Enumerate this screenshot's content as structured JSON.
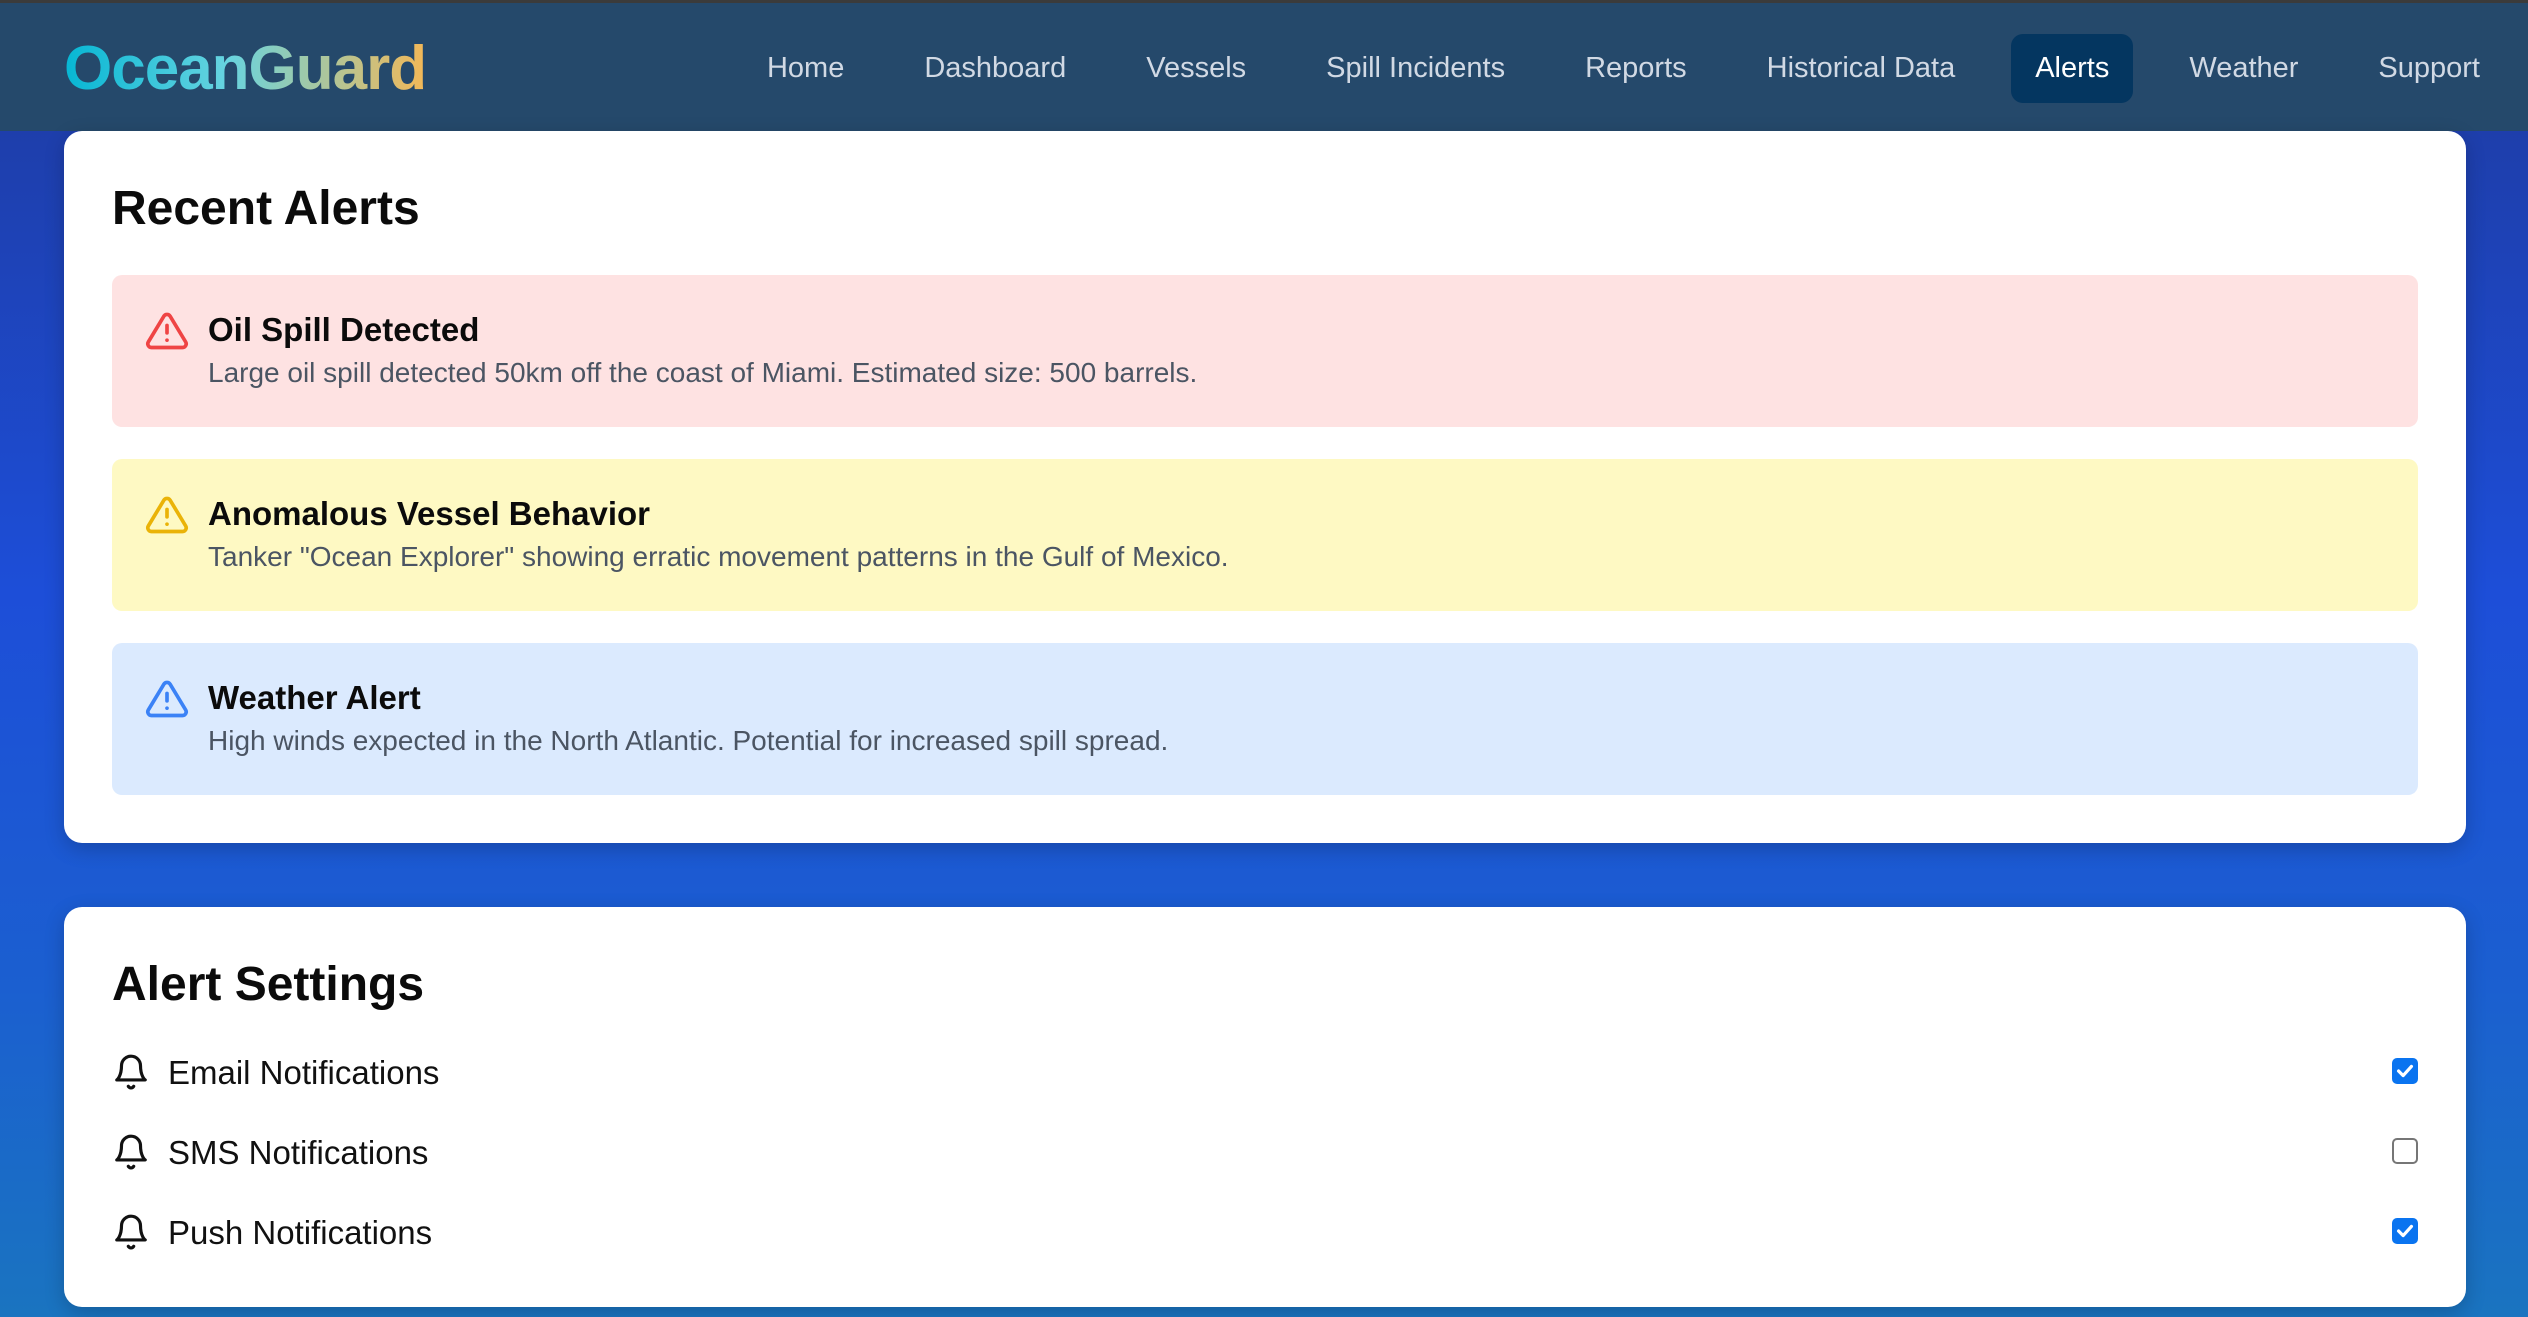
{
  "header": {
    "logo": "OceanGuard",
    "nav": [
      "Home",
      "Dashboard",
      "Vessels",
      "Spill Incidents",
      "Reports",
      "Historical Data",
      "Alerts",
      "Weather",
      "Support"
    ],
    "active": "Alerts"
  },
  "recent": {
    "title": "Recent Alerts",
    "alerts": [
      {
        "title": "Oil Spill Detected",
        "desc": "Large oil spill detected 50km off the coast of Miami. Estimated size: 500 barrels.",
        "icon": "warning-triangle-icon",
        "color": "#ef4444",
        "bg": "#fee2e2"
      },
      {
        "title": "Anomalous Vessel Behavior",
        "desc": "Tanker \"Ocean Explorer\" showing erratic movement patterns in the Gulf of Mexico.",
        "icon": "warning-triangle-icon",
        "color": "#eab308",
        "bg": "#fef9c3"
      },
      {
        "title": "Weather Alert",
        "desc": "High winds expected in the North Atlantic. Potential for increased spill spread.",
        "icon": "warning-triangle-icon",
        "color": "#3b82f6",
        "bg": "#dbeafe"
      }
    ]
  },
  "settings": {
    "title": "Alert Settings",
    "items": [
      {
        "label": "Email Notifications",
        "checked": true
      },
      {
        "label": "SMS Notifications",
        "checked": false
      },
      {
        "label": "Push Notifications",
        "checked": true
      }
    ]
  }
}
